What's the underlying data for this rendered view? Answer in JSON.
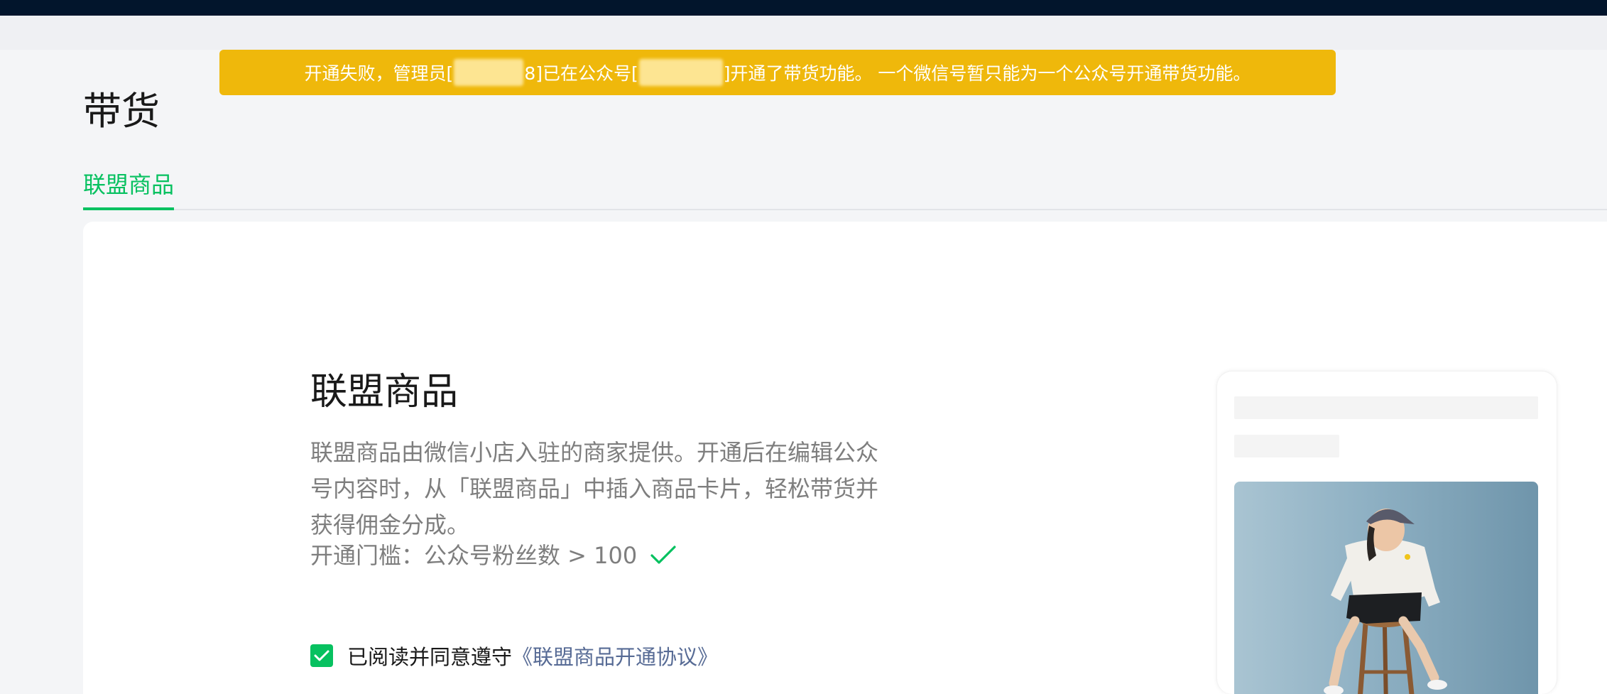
{
  "alert": {
    "text_part1": "开通失败，管理员[",
    "text_part2": "8]已在公众号[",
    "text_part3": "]开通了带货功能。 一个微信号暂只能为一个公众号开通带货功能。"
  },
  "page": {
    "title": "带货"
  },
  "tabs": [
    {
      "label": "联盟商品",
      "active": true
    }
  ],
  "card": {
    "title": "联盟商品",
    "description": "联盟商品由微信小店入驻的商家提供。开通后在编辑公众号内容时，从「联盟商品」中插入商品卡片，轻松带货并获得佣金分成。",
    "threshold": "开通门槛：公众号粉丝数 > 100",
    "threshold_met_icon": "check-icon",
    "agreement": {
      "checked": true,
      "prefix": "已阅读并同意遵守",
      "link": "《联盟商品开通协议》"
    }
  },
  "colors": {
    "top_bar": "#02152c",
    "alert_bg": "#efb80b",
    "accent_green": "#07c160",
    "link_blue": "#576b95"
  }
}
